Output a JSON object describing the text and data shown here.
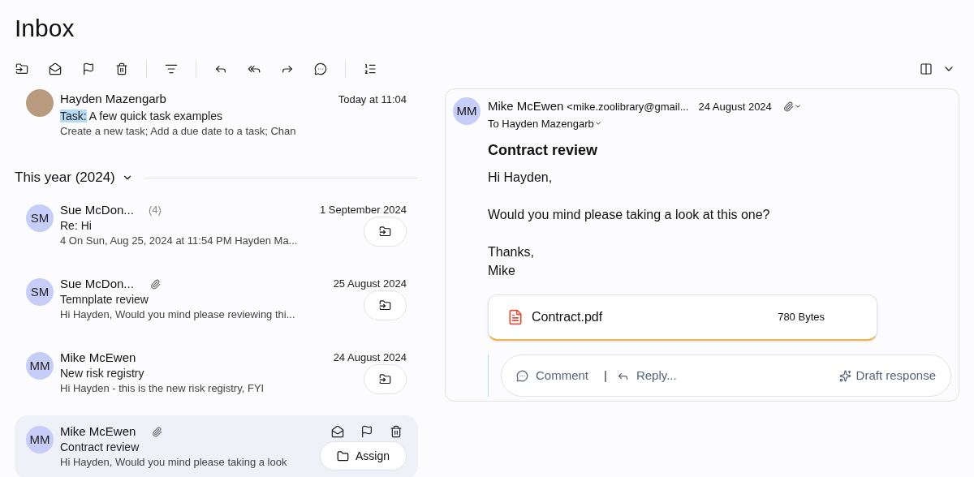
{
  "title": "Inbox",
  "pinned_email": {
    "sender": "Hayden Mazengarb",
    "tag": "Task:",
    "subject": "A few quick task examples",
    "preview": "Create a new task; Add a due date to a task; Chan",
    "time": "Today at 11:04"
  },
  "section": {
    "label": "This year (2024)",
    "expanded": true
  },
  "emails": [
    {
      "initials": "SM",
      "sender": "Sue McDon...",
      "count": "(4)",
      "attachment": false,
      "subject": "Re: Hi",
      "preview": "4 On Sun, Aug 25, 2024 at 11:54 PM Hayden Ma...",
      "date": "1 September 2024",
      "selected": false
    },
    {
      "initials": "SM",
      "sender": "Sue McDon...",
      "attachment": true,
      "subject": "Temnplate review",
      "preview": "Hi Hayden, Would you mind please reviewing thi...",
      "date": "25 August 2024",
      "selected": false
    },
    {
      "initials": "MM",
      "sender": "Mike McEwen",
      "attachment": false,
      "subject": "New risk registry",
      "preview": "Hi Hayden - this is the new risk registry, FYI",
      "date": "24 August 2024",
      "selected": false
    },
    {
      "initials": "MM",
      "sender": "Mike McEwen",
      "attachment": true,
      "subject": "Contract review",
      "preview": "Hi Hayden, Would you mind please taking a look",
      "action": "Assign",
      "selected": true
    }
  ],
  "reading_pane": {
    "initials": "MM",
    "sender": "Mike McEwen",
    "address": "<mike.zoolibrary@gmail...",
    "date": "24 August 2024",
    "to": "To Hayden Mazengarb",
    "subject": "Contract review",
    "body": [
      [
        "Hi Hayden,"
      ],
      [
        "Would you mind please taking a look at this one?"
      ],
      [
        "Thanks,",
        "Mike"
      ]
    ],
    "attachment": {
      "name": "Contract.pdf",
      "size": "780 Bytes"
    },
    "composer": {
      "comment": "Comment",
      "separator": "|",
      "reply": "Reply...",
      "draft": "Draft response"
    }
  }
}
